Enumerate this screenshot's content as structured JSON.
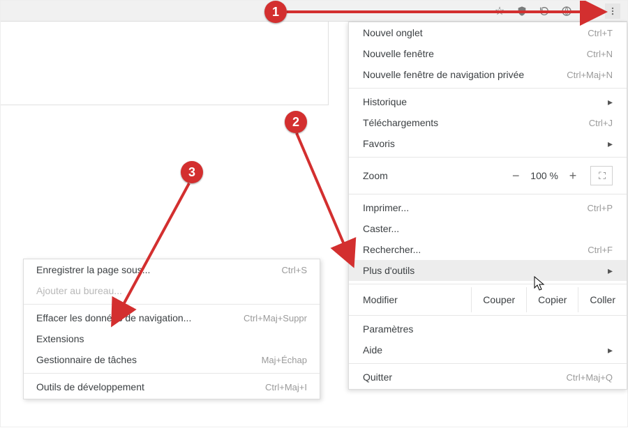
{
  "toolbar": {
    "icons": [
      "star-icon",
      "shield-icon",
      "refresh-icon",
      "globe-icon",
      "key-icon"
    ]
  },
  "menu": {
    "new_tab": {
      "label": "Nouvel onglet",
      "short": "Ctrl+T"
    },
    "new_window": {
      "label": "Nouvelle fenêtre",
      "short": "Ctrl+N"
    },
    "new_incognito": {
      "label": "Nouvelle fenêtre de navigation privée",
      "short": "Ctrl+Maj+N"
    },
    "history": {
      "label": "Historique"
    },
    "downloads": {
      "label": "Téléchargements",
      "short": "Ctrl+J"
    },
    "bookmarks": {
      "label": "Favoris"
    },
    "zoom": {
      "label": "Zoom",
      "minus": "−",
      "value": "100 %",
      "plus": "+"
    },
    "print": {
      "label": "Imprimer...",
      "short": "Ctrl+P"
    },
    "cast": {
      "label": "Caster..."
    },
    "find": {
      "label": "Rechercher...",
      "short": "Ctrl+F"
    },
    "more_tools": {
      "label": "Plus d'outils"
    },
    "edit": {
      "label": "Modifier",
      "cut": "Couper",
      "copy": "Copier",
      "paste": "Coller"
    },
    "settings": {
      "label": "Paramètres"
    },
    "help": {
      "label": "Aide"
    },
    "quit": {
      "label": "Quitter",
      "short": "Ctrl+Maj+Q"
    }
  },
  "submenu": {
    "save_as": {
      "label": "Enregistrer la page sous...",
      "short": "Ctrl+S"
    },
    "add_desktop": {
      "label": "Ajouter au bureau..."
    },
    "clear_data": {
      "label": "Effacer les données de navigation...",
      "short": "Ctrl+Maj+Suppr"
    },
    "extensions": {
      "label": "Extensions"
    },
    "task_mgr": {
      "label": "Gestionnaire de tâches",
      "short": "Maj+Échap"
    },
    "dev_tools": {
      "label": "Outils de développement",
      "short": "Ctrl+Maj+I"
    }
  },
  "annotations": {
    "b1": "1",
    "b2": "2",
    "b3": "3"
  }
}
